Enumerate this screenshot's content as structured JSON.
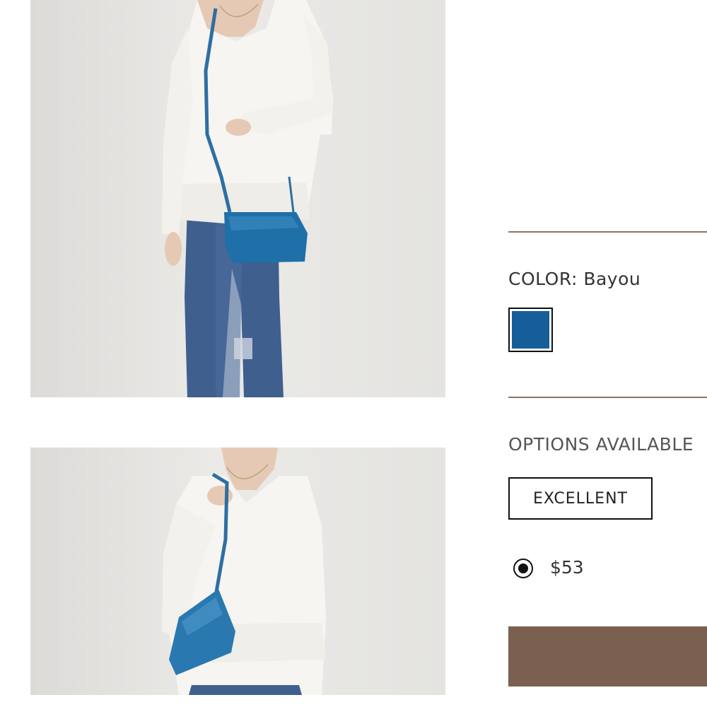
{
  "gallery": {
    "images": [
      {
        "subject": "model-with-crossbody-bag-front"
      },
      {
        "subject": "model-holding-crossbody-bag-strap"
      }
    ]
  },
  "product": {
    "color": {
      "label": "COLOR: Bayou",
      "swatch_hex": "#155e99"
    },
    "options": {
      "heading": "OPTIONS AVAILABLE",
      "condition": "EXCELLENT",
      "price": "$53",
      "selected": true
    },
    "cta": {
      "label": "",
      "color": "#7b6050"
    },
    "divider_color": "#8a7562"
  }
}
